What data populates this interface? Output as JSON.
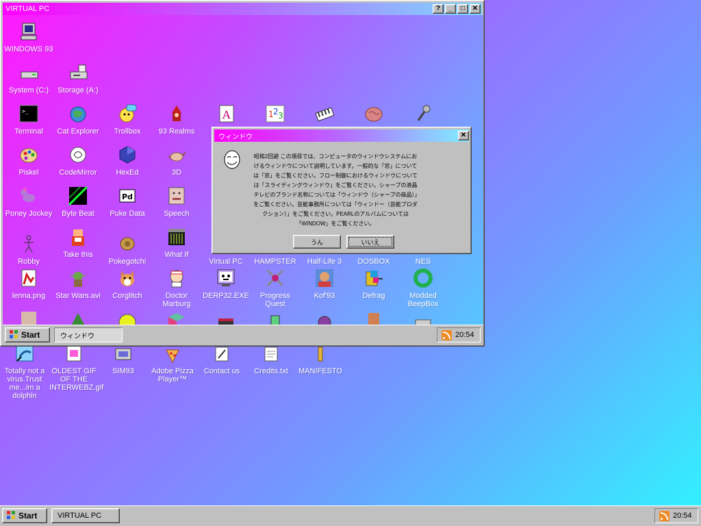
{
  "desktop": {
    "icons": [
      {
        "label": "Totally not a virus.Trust me...im a dolphin",
        "icon": "dolphin-icon"
      },
      {
        "label": "OLDEST GIF OF THE INTERWEBZ.gif",
        "icon": "gif-icon"
      },
      {
        "label": "SIM93",
        "icon": "sim-icon"
      },
      {
        "label": "Adobe Pizza Player™",
        "icon": "pizza-icon"
      },
      {
        "label": "Contact us",
        "icon": "contact-icon"
      },
      {
        "label": "Credits.txt",
        "icon": "text-file-icon"
      },
      {
        "label": "MANIFESTO",
        "icon": "manifesto-icon"
      }
    ]
  },
  "vpc": {
    "title": "VIRTUAL PC",
    "buttons": {
      "help": "?",
      "minimize": "_",
      "maximize": "□",
      "close": "✕"
    },
    "icons": {
      "windows93": "WINDOWS 93",
      "system": "System (C:)",
      "storage": "Storage (A:)",
      "terminal": "Terminal",
      "cat_explorer": "Cat Explorer",
      "trollbox": "Trollbox",
      "realms": "93 Realms",
      "acrobat": "A",
      "piskel": "Piskel",
      "codemirror": "CodeMirror",
      "hexed": "HexEd",
      "threed": "3D",
      "poney": "Poney Jockey",
      "bytebeat": "Byte Beat",
      "pukedata": "Puke Data",
      "speech": "Speech",
      "robby": "Robby",
      "takethis": "Take this",
      "pokegotchi": "Pokegotchi",
      "whatif": "What If",
      "virtualpc": "Virtual PC",
      "hampster": "HAMPSTER",
      "halflife": "Half-Life 3",
      "dosbox": "DOSBOX",
      "nes": "NES",
      "lenna": "lenna.png",
      "starwars": "Star Wars.avi",
      "corglitch": "Corglitch",
      "doctor": "Doctor Marburg",
      "derp": "DERP32.EXE",
      "progress": "Progress Quest",
      "kof": "Kof'93",
      "defrag": "Defrag",
      "beepbox": "Modded BeepBox"
    },
    "taskbar": {
      "start_label": "Start",
      "window_label": "ウィンドウ",
      "clock": "20:54"
    }
  },
  "dialog": {
    "title": "ウィンドウ",
    "close": "✕",
    "message": "昭和2回避 この項目では、コンピュータのウィンドウシステムにおけるウィンドウについて説明しています。一般的な「窓」については「窓」をご覧ください。フロー制御におけるウィンドウについては「スライディングウィンドウ」をご覧ください。シャープの液晶テレビのブランド名称については「ウィンドウ（シャープの商品）」をご覧ください。芸能事務所については「ウィンドー（芸能プロダクション）」をご覧ください。PEARLのアルバムについては「WINDOW」をご覧ください。",
    "yes_label": "うん",
    "no_label": "いいえ"
  },
  "taskbar": {
    "start_label": "Start",
    "window_label": "VIRTUAL PC",
    "clock": "20:54"
  },
  "colors": {
    "title_gradient_start": "#ff00ff",
    "title_gradient_end": "#7fd9ff",
    "chrome": "#c0c0c0"
  }
}
